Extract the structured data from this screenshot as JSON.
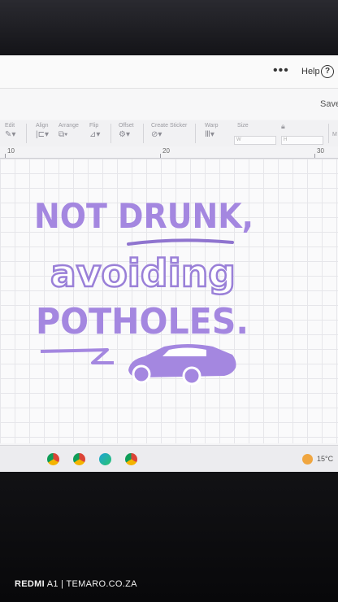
{
  "topbar": {
    "more_label": "•••",
    "help_label": "Help",
    "help_icon_glyph": "?"
  },
  "secondbar": {
    "save_label": "Save"
  },
  "toolbar": {
    "tools": [
      {
        "label": "Edit",
        "icon": "pencil-icon"
      },
      {
        "label": "Align",
        "icon": "align-icon"
      },
      {
        "label": "Arrange",
        "icon": "arrange-icon"
      },
      {
        "label": "Flip",
        "icon": "flip-icon"
      },
      {
        "label": "Offset",
        "icon": "offset-icon"
      },
      {
        "label": "Create Sticker",
        "icon": "sticker-icon"
      },
      {
        "label": "Warp",
        "icon": "warp-icon"
      },
      {
        "label": "Size",
        "icon": "size-icon"
      }
    ],
    "size_w_label": "W",
    "size_h_label": "H",
    "cut_label": "M"
  },
  "ruler": {
    "marks": [
      "10",
      "20",
      "30"
    ]
  },
  "artwork": {
    "line1": "NOT DRUNK,",
    "line2": "avoiding",
    "line3": "POTHOLES.",
    "accent_color": "#a487e0",
    "outline_color": "#8f74cf"
  },
  "taskbar": {
    "apps": [
      "chrome-icon",
      "chrome-icon",
      "edge-icon",
      "chrome-icon"
    ],
    "temperature": "15°C"
  },
  "watermark": {
    "brand": "REDMI",
    "model": "A1",
    "site": "TEMARO.CO.ZA"
  }
}
